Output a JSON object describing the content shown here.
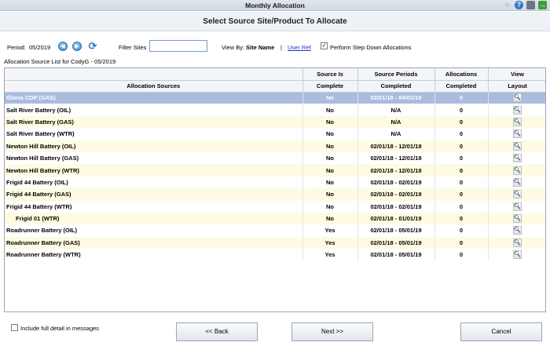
{
  "window": {
    "title": "Monthly Allocation"
  },
  "title_icons": [
    "star-icon",
    "help-icon",
    "print-icon",
    "export-icon"
  ],
  "subtitle": "Select Source Site/Product To Allocate",
  "toolbar": {
    "period_label": "Period:",
    "period_value": "05/2019",
    "filter_label": "Filter Sites",
    "filter_value": "",
    "view_by_label": "View By:",
    "site_name": "Site Name",
    "separator": "|",
    "user_ref": "User Ref",
    "step_down_label": "Perform Step Down Allocations",
    "step_down_checked": true
  },
  "list_caption": "Allocation Source List for CodyG - 05/2019",
  "table": {
    "header_top": [
      "",
      "Source Is",
      "Source Periods",
      "Allocations",
      "View"
    ],
    "header_bottom": [
      "Allocation Sources",
      "Complete",
      "Completed",
      "Completed",
      "Layout"
    ],
    "rows": [
      {
        "source": "Gloria CDP (GAS)",
        "complete": "No",
        "periods": "02/01/18 - 04/01/19",
        "allocations": "0",
        "selected": true,
        "indent": false
      },
      {
        "source": "Salt River Battery (OIL)",
        "complete": "No",
        "periods": "N/A",
        "allocations": "0",
        "selected": false,
        "indent": false
      },
      {
        "source": "Salt River Battery (GAS)",
        "complete": "No",
        "periods": "N/A",
        "allocations": "0",
        "selected": false,
        "indent": false
      },
      {
        "source": "Salt River Battery (WTR)",
        "complete": "No",
        "periods": "N/A",
        "allocations": "0",
        "selected": false,
        "indent": false
      },
      {
        "source": "Newton Hill Battery (OIL)",
        "complete": "No",
        "periods": "02/01/18 - 12/01/18",
        "allocations": "0",
        "selected": false,
        "indent": false
      },
      {
        "source": "Newton Hill Battery (GAS)",
        "complete": "No",
        "periods": "02/01/18 - 12/01/18",
        "allocations": "0",
        "selected": false,
        "indent": false
      },
      {
        "source": "Newton Hill Battery (WTR)",
        "complete": "No",
        "periods": "02/01/18 - 12/01/18",
        "allocations": "0",
        "selected": false,
        "indent": false
      },
      {
        "source": "Frigid 44 Battery (OIL)",
        "complete": "No",
        "periods": "02/01/18 - 02/01/19",
        "allocations": "0",
        "selected": false,
        "indent": false
      },
      {
        "source": "Frigid 44 Battery (GAS)",
        "complete": "No",
        "periods": "02/01/18 - 02/01/19",
        "allocations": "0",
        "selected": false,
        "indent": false
      },
      {
        "source": "Frigid 44 Battery (WTR)",
        "complete": "No",
        "periods": "02/01/18 - 02/01/19",
        "allocations": "0",
        "selected": false,
        "indent": false
      },
      {
        "source": "Frigid 01 (WTR)",
        "complete": "No",
        "periods": "02/01/18 - 01/01/19",
        "allocations": "0",
        "selected": false,
        "indent": true
      },
      {
        "source": "Roadrunner Battery (OIL)",
        "complete": "Yes",
        "periods": "02/01/18 - 05/01/19",
        "allocations": "0",
        "selected": false,
        "indent": false
      },
      {
        "source": "Roadrunner Battery (GAS)",
        "complete": "Yes",
        "periods": "02/01/18 - 05/01/19",
        "allocations": "0",
        "selected": false,
        "indent": false
      },
      {
        "source": "Roadrunner Battery (WTR)",
        "complete": "Yes",
        "periods": "02/01/18 - 05/01/19",
        "allocations": "0",
        "selected": false,
        "indent": false
      }
    ]
  },
  "footer": {
    "include_detail_label": "Include full detail in messages",
    "include_detail_checked": false,
    "back_label": "<< Back",
    "next_label": "Next >>",
    "cancel_label": "Cancel"
  }
}
